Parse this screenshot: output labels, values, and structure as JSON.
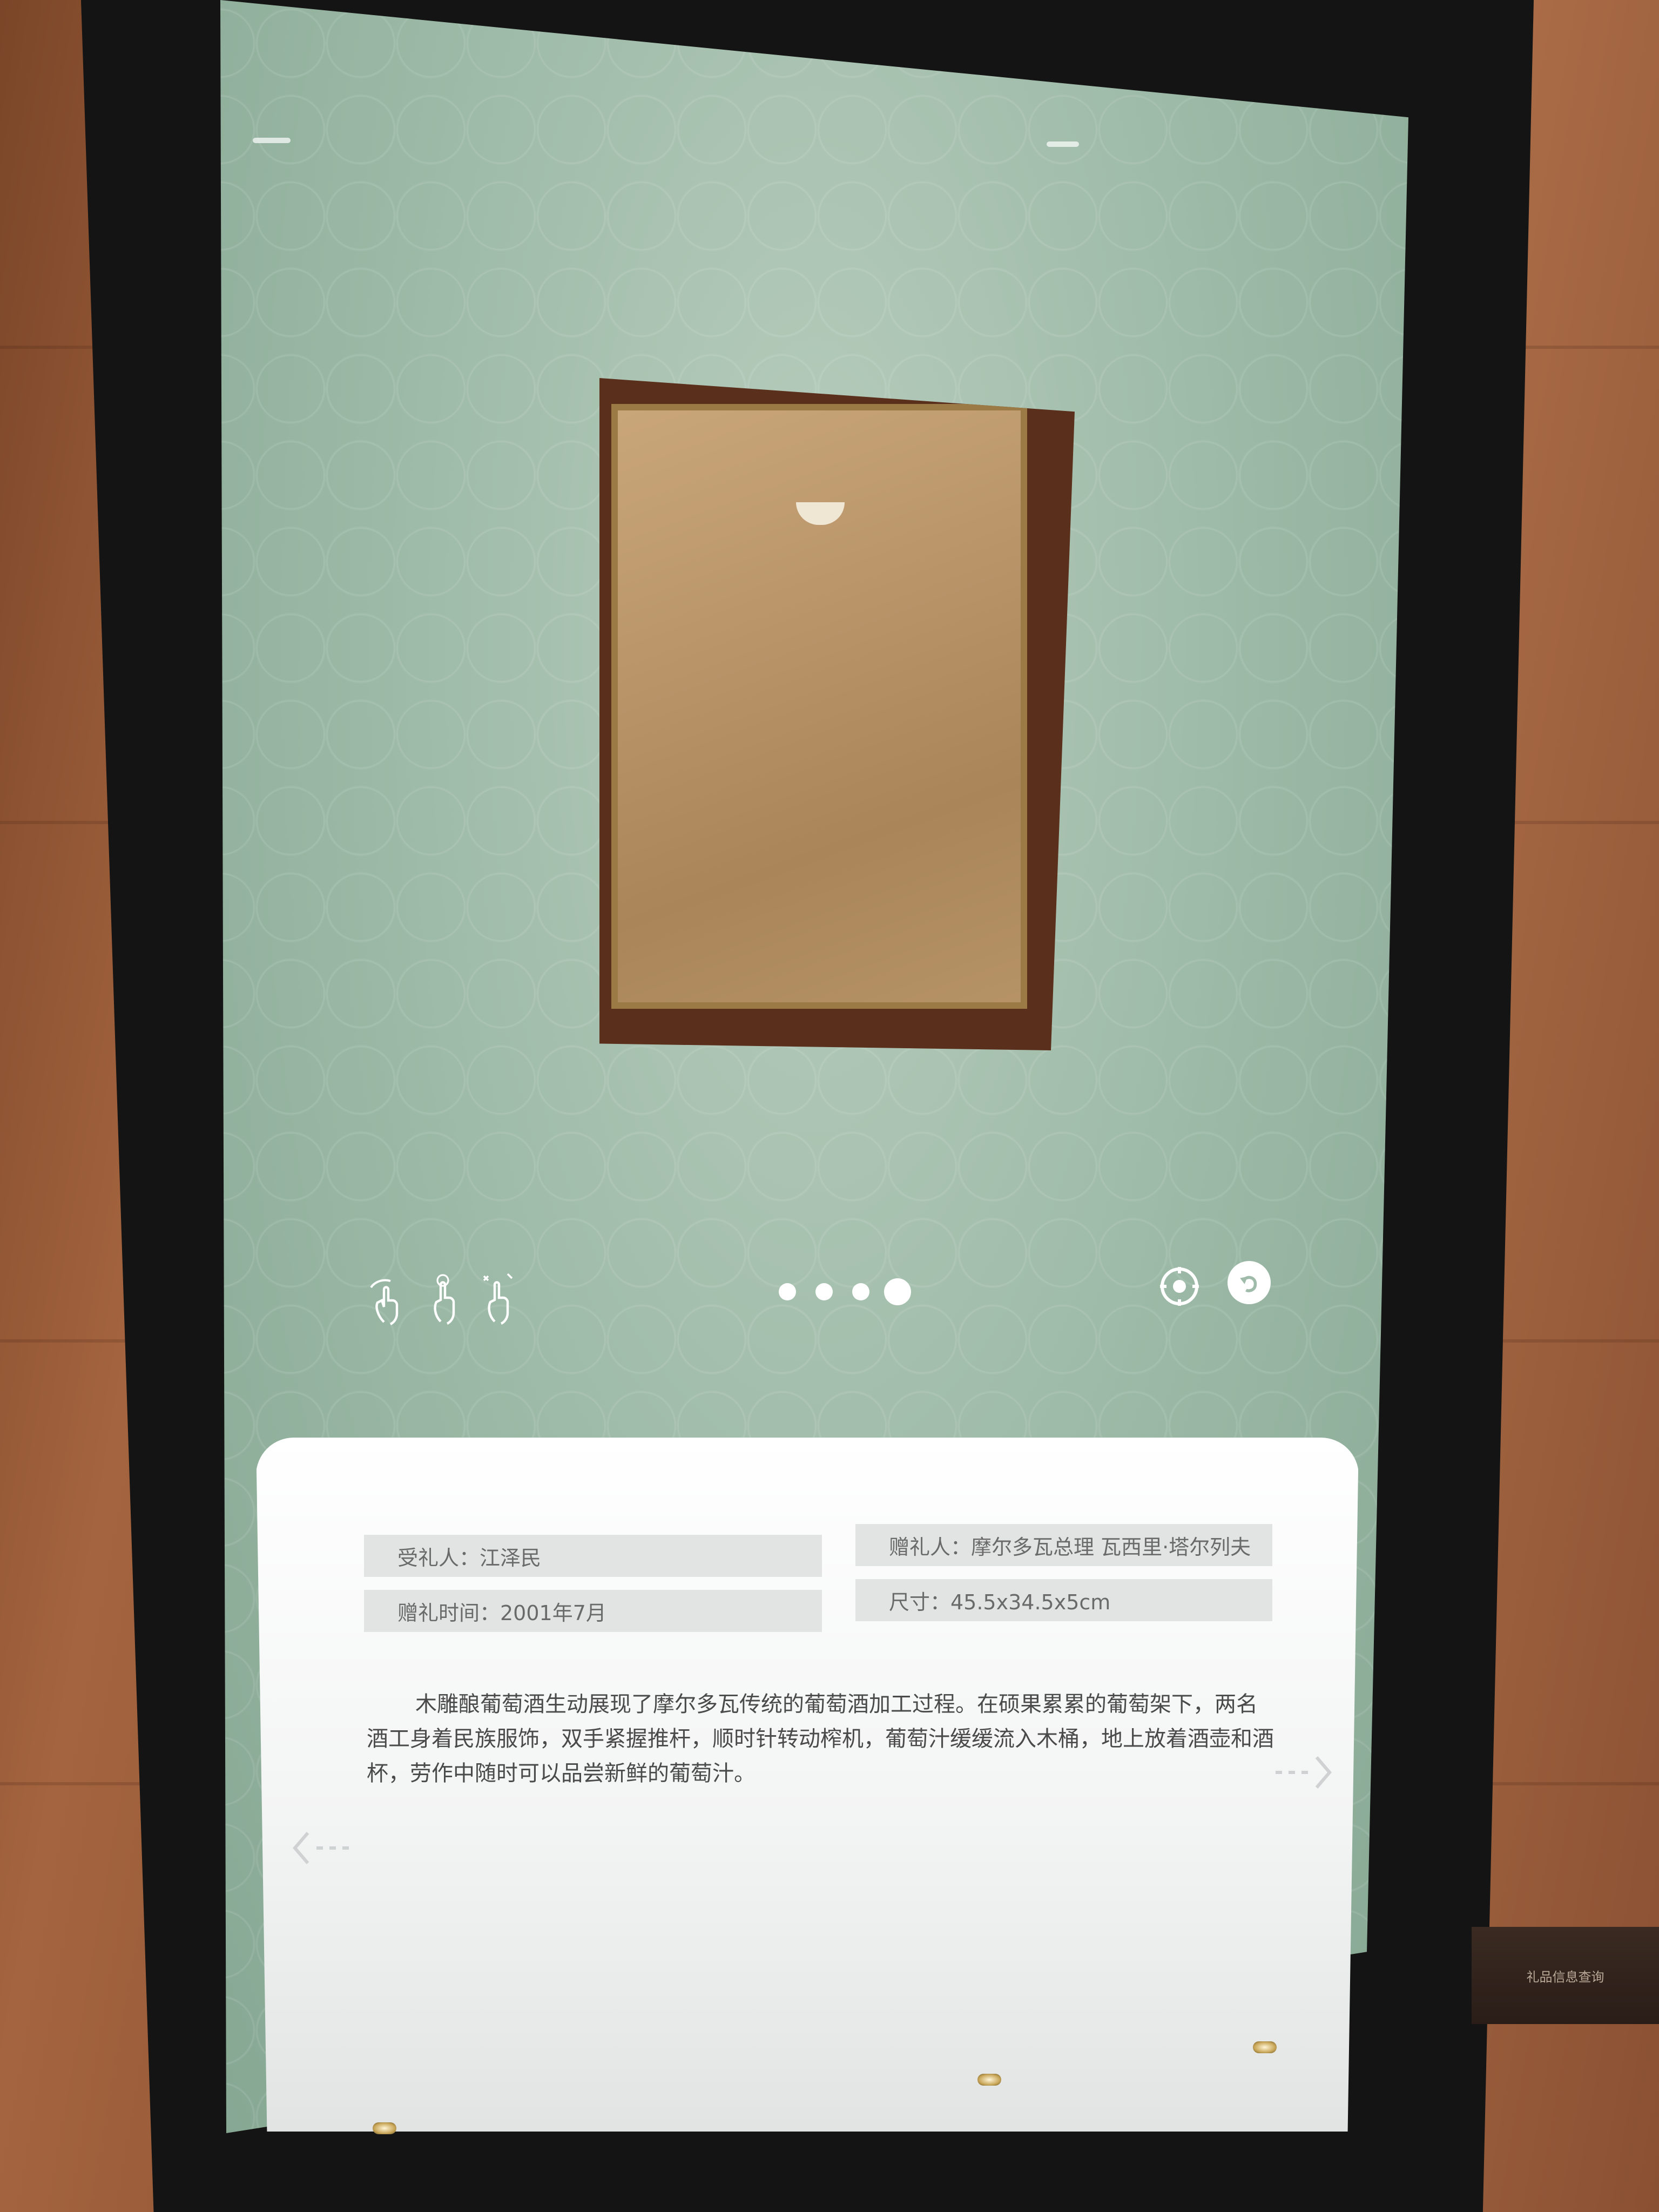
{
  "colors": {
    "screen_background": "#9fbba9",
    "panel_background": "#f3f4f4",
    "field_background": "#e2e4e3",
    "text_muted": "#6a6a6a",
    "text_body": "#4a4a4a",
    "accent_white": "#ffffff"
  },
  "toolbar": {
    "gesture_icons": [
      "rotate-hand-icon",
      "tap-hand-icon",
      "pinch-zoom-hand-icon"
    ],
    "pagination": {
      "total": 4,
      "active_index": 4
    },
    "actions": [
      "reset-view-icon",
      "back-arrow-icon"
    ]
  },
  "gift_info": {
    "recipient": "受礼人：江泽民",
    "giver": "赠礼人：摩尔多瓦总理 瓦西里·塔尔列夫",
    "date": "赠礼时间：2001年7月",
    "size": "尺寸：45.5x34.5x5cm"
  },
  "description": "木雕酿葡萄酒生动展现了摩尔多瓦传统的葡萄酒加工过程。在硕果累累的葡萄架下，两名酒工身着民族服饰，双手紧握推杆，顺时针转动榨机，葡萄汁缓缓流入木桶，地上放着酒壶和酒杯，劳作中随时可以品尝新鲜的葡萄汁。",
  "navigation": {
    "prev_icon": "chevron-left-icon",
    "next_icon": "chevron-right-icon"
  },
  "wall_plaque": {
    "text": "礼品信息查询"
  }
}
